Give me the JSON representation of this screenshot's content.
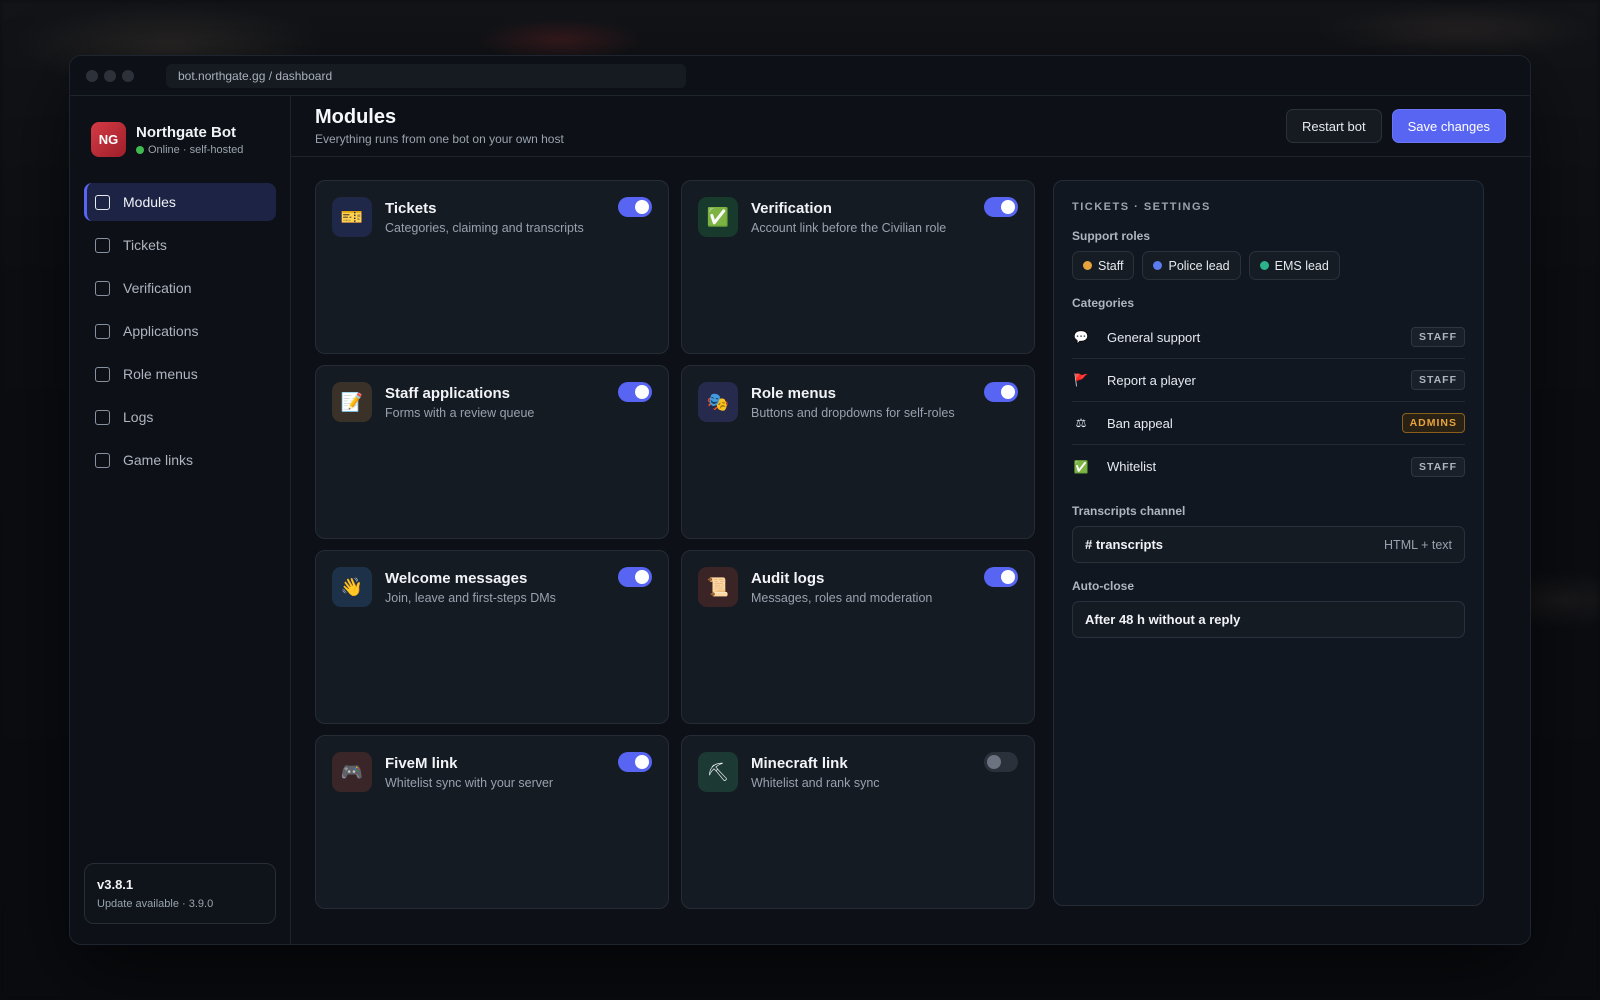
{
  "browser": {
    "url": "bot.northgate.gg / dashboard"
  },
  "brand": {
    "logo": "NG",
    "name": "Northgate Bot",
    "status": "Online · self-hosted",
    "status_color": "#3fb950"
  },
  "nav": {
    "items": [
      {
        "label": "Modules",
        "active": true
      },
      {
        "label": "Tickets"
      },
      {
        "label": "Verification"
      },
      {
        "label": "Applications"
      },
      {
        "label": "Role menus"
      },
      {
        "label": "Logs"
      },
      {
        "label": "Game links"
      }
    ]
  },
  "version": {
    "number": "v3.8.1",
    "update": "Update available · 3.9.0"
  },
  "header": {
    "title": "Modules",
    "subtitle": "Everything runs from one bot on your own host",
    "restart_label": "Restart bot",
    "save_label": "Save changes"
  },
  "accent": "#5865f2",
  "modules": [
    {
      "title": "Tickets",
      "desc": "Categories, claiming and transcripts",
      "icon": "ticket-icon",
      "glyph": "🎫",
      "enabled": true
    },
    {
      "title": "Verification",
      "desc": "Account link before the Civilian role",
      "icon": "checkmark-icon",
      "glyph": "✅",
      "enabled": true
    },
    {
      "title": "Staff applications",
      "desc": "Forms with a review queue",
      "icon": "memo-icon",
      "glyph": "📝",
      "enabled": true
    },
    {
      "title": "Role menus",
      "desc": "Buttons and dropdowns for self-roles",
      "icon": "masks-icon",
      "glyph": "🎭",
      "enabled": true
    },
    {
      "title": "Welcome messages",
      "desc": "Join, leave and first-steps DMs",
      "icon": "wave-icon",
      "glyph": "👋",
      "enabled": true
    },
    {
      "title": "Audit logs",
      "desc": "Messages, roles and moderation",
      "icon": "scroll-icon",
      "glyph": "📜",
      "enabled": true
    },
    {
      "title": "FiveM link",
      "desc": "Whitelist sync with your server",
      "icon": "gamepad-icon",
      "glyph": "🎮",
      "enabled": true
    },
    {
      "title": "Minecraft link",
      "desc": "Whitelist and rank sync",
      "icon": "pickaxe-icon",
      "glyph": "⛏",
      "enabled": false
    }
  ],
  "panel": {
    "title": "TICKETS · SETTINGS",
    "support_roles_label": "Support roles",
    "support_roles": [
      {
        "name": "Staff",
        "color": "#e8a33d"
      },
      {
        "name": "Police lead",
        "color": "#5b7bf0"
      },
      {
        "name": "EMS lead",
        "color": "#2bb38a"
      }
    ],
    "categories_label": "Categories",
    "categories": [
      {
        "name": "General support",
        "icon": "speech-bubble-icon",
        "glyph": "💬",
        "badge": "STAFF"
      },
      {
        "name": "Report a player",
        "icon": "red-flag-icon",
        "glyph": "🚩",
        "badge": "STAFF"
      },
      {
        "name": "Ban appeal",
        "icon": "scales-icon",
        "glyph": "⚖",
        "badge": "ADMINS"
      },
      {
        "name": "Whitelist",
        "icon": "checkmark-icon",
        "glyph": "✅",
        "badge": "STAFF"
      }
    ],
    "transcripts_label": "Transcripts channel",
    "transcripts_value": "# transcripts",
    "transcripts_hint": "HTML + text",
    "autoclose_label": "Auto-close",
    "autoclose_value": "After 48 h without a reply"
  }
}
